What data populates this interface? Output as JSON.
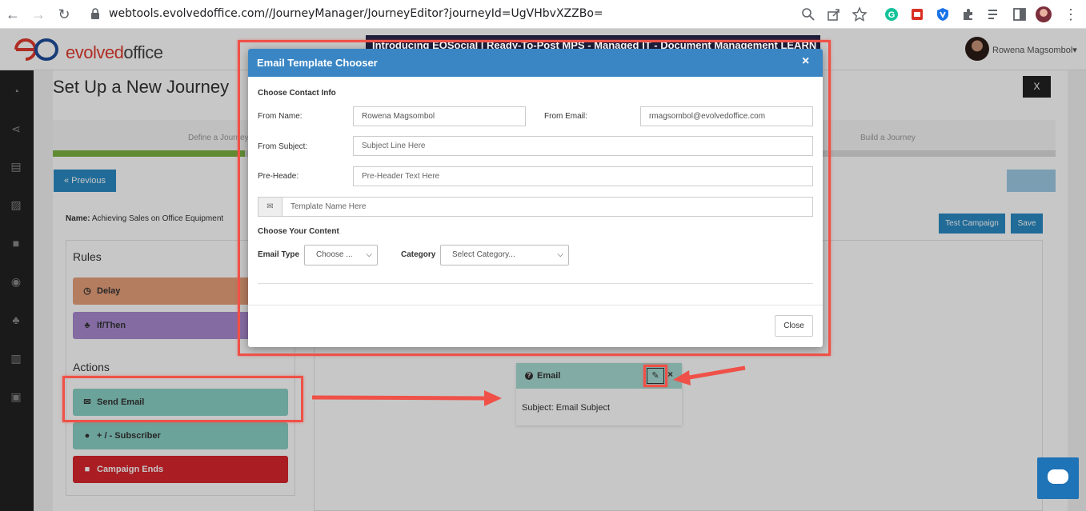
{
  "browser": {
    "url": "webtools.evolvedoffice.com//JourneyManager/JourneyEditor?journeyId=UgVHbvXZZBo="
  },
  "app": {
    "logo_prefix": "evolved",
    "logo_suffix": "office",
    "user_name": "Rowena Magsombol",
    "promo_text": "Introducing EOSocial | Ready-To-Post  MPS - Managed IT - Document Management  LEARN MORE"
  },
  "page": {
    "title": "Set Up a New Journey",
    "close_label": "X",
    "steps": [
      "Define a Journey",
      "Build a Journey"
    ],
    "previous_label": "« Previous",
    "next_label": "",
    "journey_name_label": "Name:",
    "journey_name_value": "Achieving Sales on Office Equipment",
    "test_campaign_label": "Test Campaign",
    "save_label": "Save"
  },
  "rules": {
    "heading": "Rules",
    "items": [
      {
        "label": "Delay",
        "icon": "clock-icon"
      },
      {
        "label": "If/Then",
        "icon": "sitemap-icon"
      }
    ]
  },
  "actions": {
    "heading": "Actions",
    "items": [
      {
        "label": "Send Email",
        "icon": "envelope-icon"
      },
      {
        "label": "+ / - Subscriber",
        "icon": "user-icon"
      },
      {
        "label": "Campaign Ends",
        "icon": "square-icon"
      }
    ]
  },
  "email_node": {
    "title": "Email",
    "subject": "Subject: Email Subject"
  },
  "modal": {
    "title": "Email Template Chooser",
    "close_icon": "×",
    "contact_heading": "Choose Contact Info",
    "from_name_label": "From Name:",
    "from_name_value": "Rowena Magsombol",
    "from_email_label": "From Email:",
    "from_email_value": "rmagsombol@evolvedoffice.com",
    "from_subject_label": "From Subject:",
    "from_subject_placeholder": "Subject Line Here",
    "preheader_label": "Pre-Heade:",
    "preheader_placeholder": "Pre-Header Text Here",
    "template_name_placeholder": "Template Name Here",
    "content_heading": "Choose Your Content",
    "email_type_label": "Email Type",
    "email_type_value": "Choose ...",
    "category_label": "Category",
    "category_value": "Select Category...",
    "close_button": "Close"
  },
  "colors": {
    "modal_header": "#3a86c5",
    "highlight": "#ef5148",
    "action_teal": "#8ad0c4",
    "campaign_red": "#d9262d"
  }
}
